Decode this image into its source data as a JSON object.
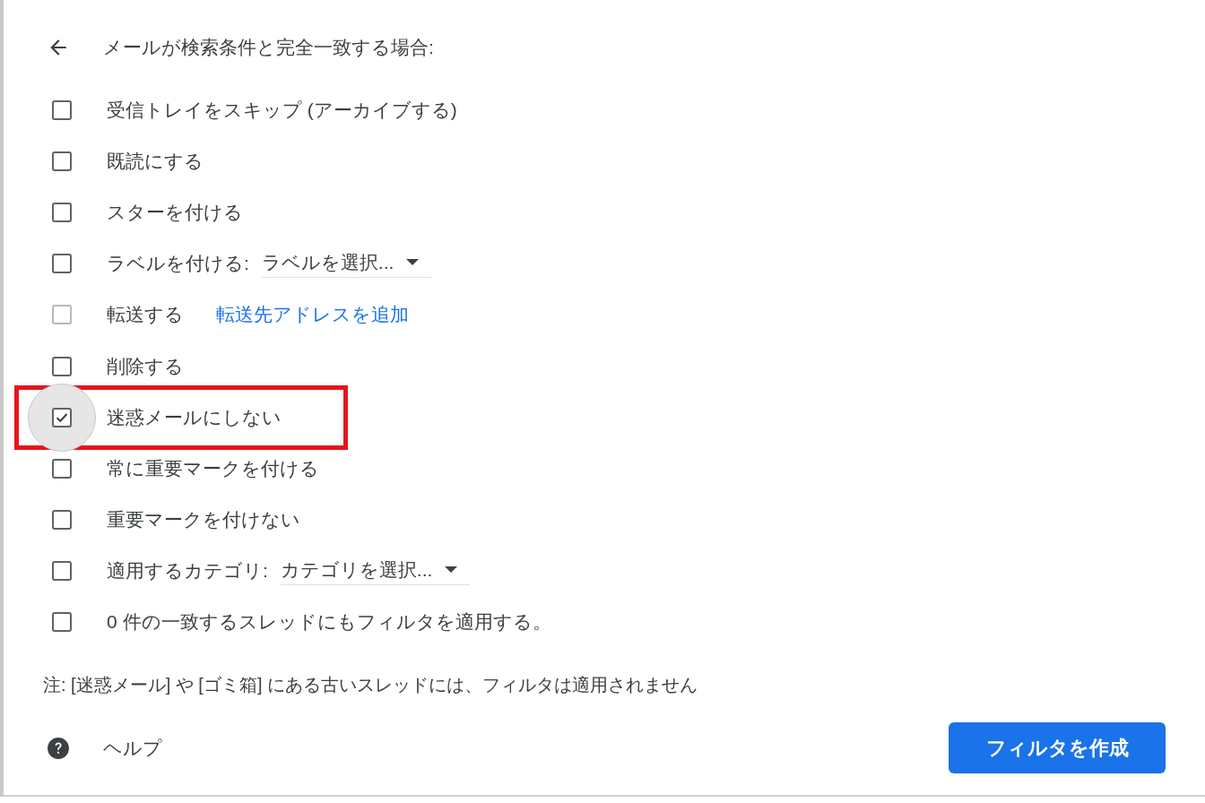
{
  "header": {
    "title": "メールが検索条件と完全一致する場合:"
  },
  "options": [
    {
      "kind": "plain",
      "label": "受信トレイをスキップ (アーカイブする)",
      "checked": false,
      "disabled": false,
      "focused": false,
      "highlighted": false
    },
    {
      "kind": "plain",
      "label": "既読にする",
      "checked": false,
      "disabled": false,
      "focused": false,
      "highlighted": false
    },
    {
      "kind": "plain",
      "label": "スターを付ける",
      "checked": false,
      "disabled": false,
      "focused": false,
      "highlighted": false
    },
    {
      "kind": "select",
      "label": "ラベルを付ける:",
      "select": "ラベルを選択...",
      "checked": false,
      "disabled": false,
      "focused": false,
      "highlighted": false
    },
    {
      "kind": "link",
      "label": "転送する",
      "link": "転送先アドレスを追加",
      "checked": false,
      "disabled": true,
      "focused": false,
      "highlighted": false
    },
    {
      "kind": "plain",
      "label": "削除する",
      "checked": false,
      "disabled": false,
      "focused": false,
      "highlighted": false
    },
    {
      "kind": "plain",
      "label": "迷惑メールにしない",
      "checked": true,
      "disabled": false,
      "focused": true,
      "highlighted": true
    },
    {
      "kind": "plain",
      "label": "常に重要マークを付ける",
      "checked": false,
      "disabled": false,
      "focused": false,
      "highlighted": false
    },
    {
      "kind": "plain",
      "label": "重要マークを付けない",
      "checked": false,
      "disabled": false,
      "focused": false,
      "highlighted": false
    },
    {
      "kind": "select",
      "label": "適用するカテゴリ:",
      "select": "カテゴリを選択...",
      "checked": false,
      "disabled": false,
      "focused": false,
      "highlighted": false
    },
    {
      "kind": "plain",
      "label": "0 件の一致するスレッドにもフィルタを適用する。",
      "checked": false,
      "disabled": false,
      "focused": false,
      "highlighted": false
    }
  ],
  "note": "注: [迷惑メール] や [ゴミ箱] にある古いスレッドには、フィルタは適用されません",
  "footer": {
    "help": "ヘルプ",
    "create_button": "フィルタを作成"
  }
}
